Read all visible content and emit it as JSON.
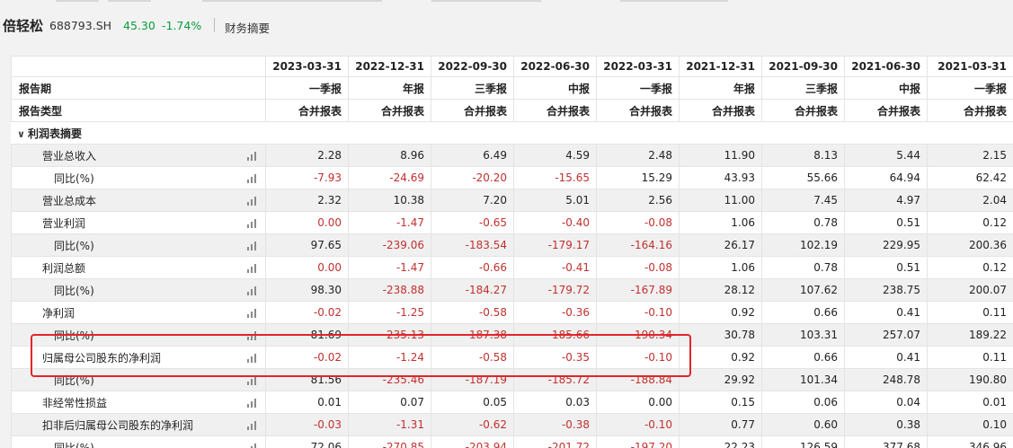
{
  "stock": {
    "name": "倍轻松",
    "code": "688793.SH",
    "price": "45.30",
    "change": "-1.74%",
    "tab": "财务摘要"
  },
  "colors": {
    "negative": "#c0312e",
    "positive_quote": "#0b9a3c",
    "highlight_box": "#e0262c"
  },
  "columns": [
    {
      "date": "2023-03-31",
      "period": "一季报",
      "type": "合并报表"
    },
    {
      "date": "2022-12-31",
      "period": "年报",
      "type": "合并报表"
    },
    {
      "date": "2022-09-30",
      "period": "三季报",
      "type": "合并报表"
    },
    {
      "date": "2022-06-30",
      "period": "中报",
      "type": "合并报表"
    },
    {
      "date": "2022-03-31",
      "period": "一季报",
      "type": "合并报表"
    },
    {
      "date": "2021-12-31",
      "period": "年报",
      "type": "合并报表"
    },
    {
      "date": "2021-09-30",
      "period": "三季报",
      "type": "合并报表"
    },
    {
      "date": "2021-06-30",
      "period": "中报",
      "type": "合并报表"
    },
    {
      "date": "2021-03-31",
      "period": "一季报",
      "type": "合并报表"
    }
  ],
  "header_labels": {
    "period": "报告期",
    "type": "报告类型"
  },
  "section": {
    "title": "利润表摘要",
    "caret_icon": "chevron-down-icon"
  },
  "rows": [
    {
      "label": "营业总收入",
      "level": 1,
      "values": [
        "2.28",
        "8.96",
        "6.49",
        "4.59",
        "2.48",
        "11.90",
        "8.13",
        "5.44",
        "2.15"
      ]
    },
    {
      "label": "同比(%)",
      "level": 2,
      "values": [
        "-7.93",
        "-24.69",
        "-20.20",
        "-15.65",
        "15.29",
        "43.93",
        "55.66",
        "64.94",
        "62.42"
      ]
    },
    {
      "label": "营业总成本",
      "level": 1,
      "values": [
        "2.32",
        "10.38",
        "7.20",
        "5.01",
        "2.56",
        "11.00",
        "7.45",
        "4.97",
        "2.04"
      ]
    },
    {
      "label": "营业利润",
      "level": 1,
      "values": [
        "0.00",
        "-1.47",
        "-0.65",
        "-0.40",
        "-0.08",
        "1.06",
        "0.78",
        "0.51",
        "0.12"
      ]
    },
    {
      "label": "同比(%)",
      "level": 2,
      "values": [
        "97.65",
        "-239.06",
        "-183.54",
        "-179.17",
        "-164.16",
        "26.17",
        "102.19",
        "229.95",
        "200.36"
      ]
    },
    {
      "label": "利润总额",
      "level": 1,
      "values": [
        "0.00",
        "-1.47",
        "-0.66",
        "-0.41",
        "-0.08",
        "1.06",
        "0.78",
        "0.51",
        "0.12"
      ]
    },
    {
      "label": "同比(%)",
      "level": 2,
      "values": [
        "98.30",
        "-238.88",
        "-184.27",
        "-179.72",
        "-167.89",
        "28.12",
        "107.62",
        "238.75",
        "200.07"
      ]
    },
    {
      "label": "净利润",
      "level": 1,
      "values": [
        "-0.02",
        "-1.25",
        "-0.58",
        "-0.36",
        "-0.10",
        "0.92",
        "0.66",
        "0.41",
        "0.11"
      ]
    },
    {
      "label": "同比(%)",
      "level": 2,
      "values": [
        "81.69",
        "-235.13",
        "-187.38",
        "-185.66",
        "-190.34",
        "30.78",
        "103.31",
        "257.07",
        "189.22"
      ]
    },
    {
      "label": "归属母公司股东的净利润",
      "level": 1,
      "values": [
        "-0.02",
        "-1.24",
        "-0.58",
        "-0.35",
        "-0.10",
        "0.92",
        "0.66",
        "0.41",
        "0.11"
      ]
    },
    {
      "label": "同比(%)",
      "level": 2,
      "values": [
        "81.56",
        "-235.46",
        "-187.19",
        "-185.72",
        "-188.84",
        "29.92",
        "101.34",
        "248.78",
        "190.80"
      ]
    },
    {
      "label": "非经常性损益",
      "level": 1,
      "values": [
        "0.01",
        "0.07",
        "0.05",
        "0.03",
        "0.00",
        "0.15",
        "0.06",
        "0.04",
        "0.01"
      ]
    },
    {
      "label": "扣非后归属母公司股东的净利润",
      "level": 1,
      "values": [
        "-0.03",
        "-1.31",
        "-0.62",
        "-0.38",
        "-0.10",
        "0.77",
        "0.60",
        "0.38",
        "0.10"
      ]
    },
    {
      "label": "同比(%)",
      "level": 2,
      "values": [
        "72.06",
        "-270.85",
        "-203.94",
        "-201.72",
        "-197.20",
        "22.23",
        "126.59",
        "377.68",
        "346.96"
      ]
    }
  ]
}
